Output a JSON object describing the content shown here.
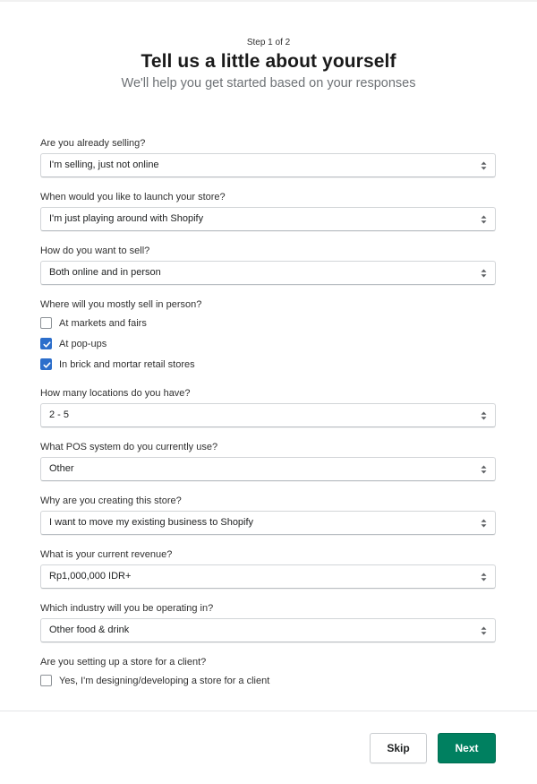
{
  "header": {
    "step": "Step 1 of 2",
    "title": "Tell us a little about yourself",
    "subtitle": "We'll help you get started based on your responses"
  },
  "fields": {
    "selling": {
      "label": "Are you already selling?",
      "value": "I'm selling, just not online"
    },
    "launch": {
      "label": "When would you like to launch your store?",
      "value": "I'm just playing around with Shopify"
    },
    "sell_how": {
      "label": "How do you want to sell?",
      "value": "Both online and in person"
    },
    "in_person": {
      "label": "Where will you mostly sell in person?",
      "options": [
        {
          "label": "At markets and fairs",
          "checked": false
        },
        {
          "label": "At pop-ups",
          "checked": true
        },
        {
          "label": "In brick and mortar retail stores",
          "checked": true
        }
      ]
    },
    "locations": {
      "label": "How many locations do you have?",
      "value": "2 - 5"
    },
    "pos": {
      "label": "What POS system do you currently use?",
      "value": "Other"
    },
    "reason": {
      "label": "Why are you creating this store?",
      "value": "I want to move my existing business to Shopify"
    },
    "revenue": {
      "label": "What is your current revenue?",
      "value": "Rp1,000,000 IDR+"
    },
    "industry": {
      "label": "Which industry will you be operating in?",
      "value": "Other food & drink"
    },
    "client": {
      "label": "Are you setting up a store for a client?",
      "options": [
        {
          "label": "Yes, I'm designing/developing a store for a client",
          "checked": false
        }
      ]
    }
  },
  "footer": {
    "skip_label": "Skip",
    "next_label": "Next"
  },
  "colors": {
    "primary": "#008060",
    "checkbox_checked": "#2c6ecb",
    "subtitle": "#6d7175"
  }
}
